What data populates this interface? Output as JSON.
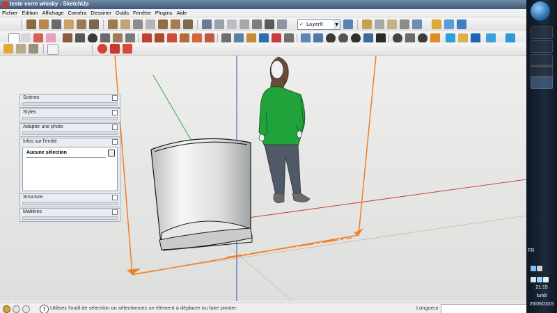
{
  "window": {
    "title": "teste verre whisky - SketchUp"
  },
  "menu": [
    "Fichier",
    "Edition",
    "Affichage",
    "Caméra",
    "Dessiner",
    "Outils",
    "Fenêtre",
    "Plugins",
    "Aide"
  ],
  "layer": {
    "checked": "✓",
    "value": "Layer0"
  },
  "trays": {
    "scenes": "Scènes",
    "styles": "Styles",
    "adapter": "Adapter une photo",
    "entity": "Infos sur l'entité",
    "selection": "Aucune sélection",
    "structure": "Structure",
    "materials": "Matières"
  },
  "status": {
    "message": "Utilisez l'outil de sélection ou sélectionnez un élément à déplacer ou faire pivoter.",
    "measure_label": "Longueur",
    "measure_value": ""
  },
  "taskbar": {
    "lang": "FR",
    "time": "21:15",
    "day": "lundi",
    "date": "25/05/2015"
  },
  "colors": {
    "axis_orange": "#f07d1e",
    "axis_red": "#d04040",
    "axis_green": "#3aa84a",
    "axis_blue": "#3a4fc0",
    "figure_shirt": "#1fa33a",
    "figure_jeans": "#4f5968"
  },
  "icons": {
    "app": "sketchup-icon",
    "start": "windows-start-icon",
    "help": "help-circle-icon"
  }
}
